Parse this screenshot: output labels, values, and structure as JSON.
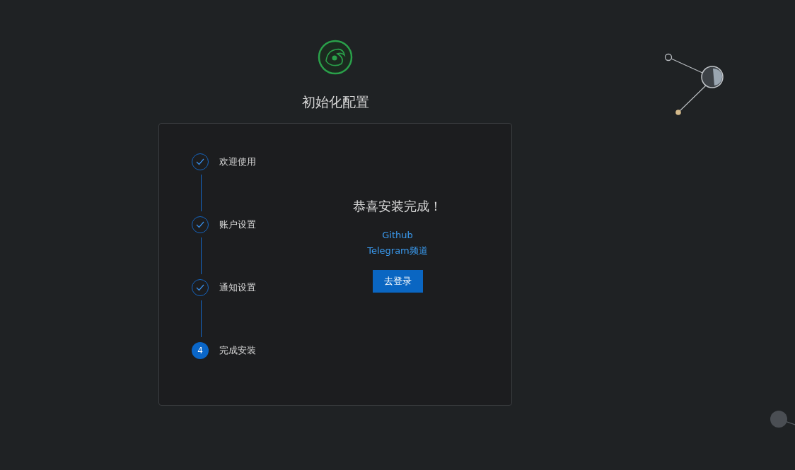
{
  "title": "初始化配置",
  "steps": [
    {
      "label": "欢迎使用",
      "done": true
    },
    {
      "label": "账户设置",
      "done": true
    },
    {
      "label": "通知设置",
      "done": true
    },
    {
      "label": "完成安装",
      "done": false,
      "number": "4"
    }
  ],
  "result": {
    "heading": "恭喜安装完成！",
    "links": [
      "Github",
      "Telegram频道"
    ],
    "button": "去登录"
  }
}
